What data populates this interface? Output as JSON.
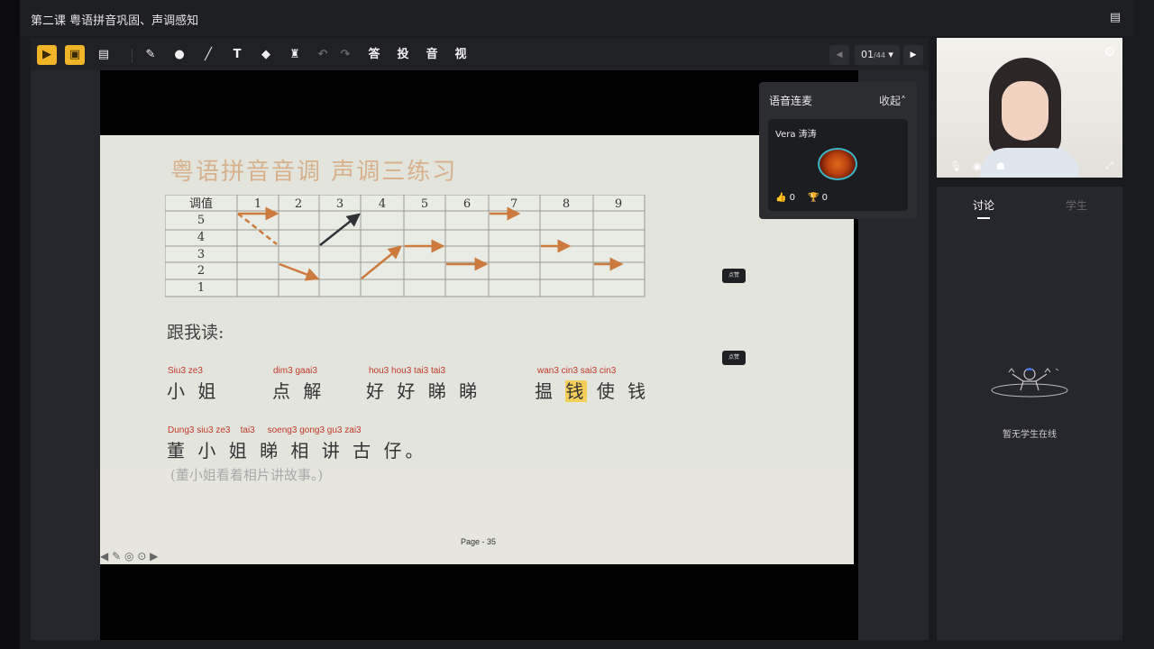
{
  "window": {
    "title": "第二课 粤语拼音巩固、声调感知"
  },
  "toolbar": {
    "tools": [
      {
        "name": "ppt-tool",
        "glyph": "▶",
        "style": "yellow"
      },
      {
        "name": "screen-share-tool",
        "glyph": "▣",
        "style": "yellow"
      },
      {
        "name": "whiteboard-tool",
        "glyph": "▤",
        "style": ""
      },
      {
        "name": "pen-tool",
        "glyph": "✎",
        "style": ""
      },
      {
        "name": "shape-tool",
        "glyph": "●",
        "style": ""
      },
      {
        "name": "line-tool",
        "glyph": "╱",
        "style": ""
      },
      {
        "name": "text-tool",
        "glyph": "T",
        "style": ""
      },
      {
        "name": "eraser-tool",
        "glyph": "◆",
        "style": ""
      },
      {
        "name": "stamp-tool",
        "glyph": "♜",
        "style": ""
      },
      {
        "name": "undo-tool",
        "glyph": "↶",
        "style": "disabled"
      },
      {
        "name": "redo-tool",
        "glyph": "↷",
        "style": "disabled"
      },
      {
        "name": "answer-tool",
        "glyph": "答",
        "style": ""
      },
      {
        "name": "vote-tool",
        "glyph": "投",
        "style": ""
      },
      {
        "name": "audio-tool",
        "glyph": "音",
        "style": ""
      },
      {
        "name": "video-tool",
        "glyph": "视",
        "style": ""
      }
    ],
    "page_current": "01",
    "page_total": "/44"
  },
  "slide": {
    "title": "粤语拼音音调 声调三练习",
    "table": {
      "header": [
        "调值",
        "1",
        "2",
        "3",
        "4",
        "5",
        "6",
        "7",
        "8",
        "9"
      ],
      "rows": [
        "5",
        "4",
        "3",
        "2",
        "1"
      ]
    },
    "follow_label": "跟我读:",
    "words": [
      {
        "pinyin": "Siu3   ze3",
        "hanzi": "小 姐"
      },
      {
        "pinyin": "dim3  gaai3",
        "hanzi": "点 解"
      },
      {
        "pinyin": "hou3 hou3 tai3 tai3",
        "hanzi": "好 好 睇 睇"
      },
      {
        "pinyin": "wan3 cin3 sai3 cin3",
        "hanzi_pre": "揾 ",
        "hanzi_hl": "钱",
        "hanzi_post": " 使 钱"
      }
    ],
    "sentence": {
      "pinyin": "Dung3 siu3 ze3    tai3     soeng3 gong3 gu3 zai3",
      "hanzi": "董 小 姐 睇 相 讲 古 仔。",
      "translation": "(董小姐看着相片讲故事。)"
    },
    "page_label": "Page - 35",
    "stamp_label": "点赞"
  },
  "voice": {
    "title": "语音连麦",
    "collapse": "收起",
    "participant": "Vera 涛涛",
    "likes": "0",
    "trophies": "0"
  },
  "chat": {
    "tab_discussion": "讨论",
    "tab_students": "学生",
    "empty_text": "暂无学生在线"
  },
  "colors": {
    "accent_yellow": "#f0b429",
    "arrow_orange": "#cc7a3e",
    "arrow_dark": "#2f3338",
    "pinyin_red": "#c0392b"
  }
}
